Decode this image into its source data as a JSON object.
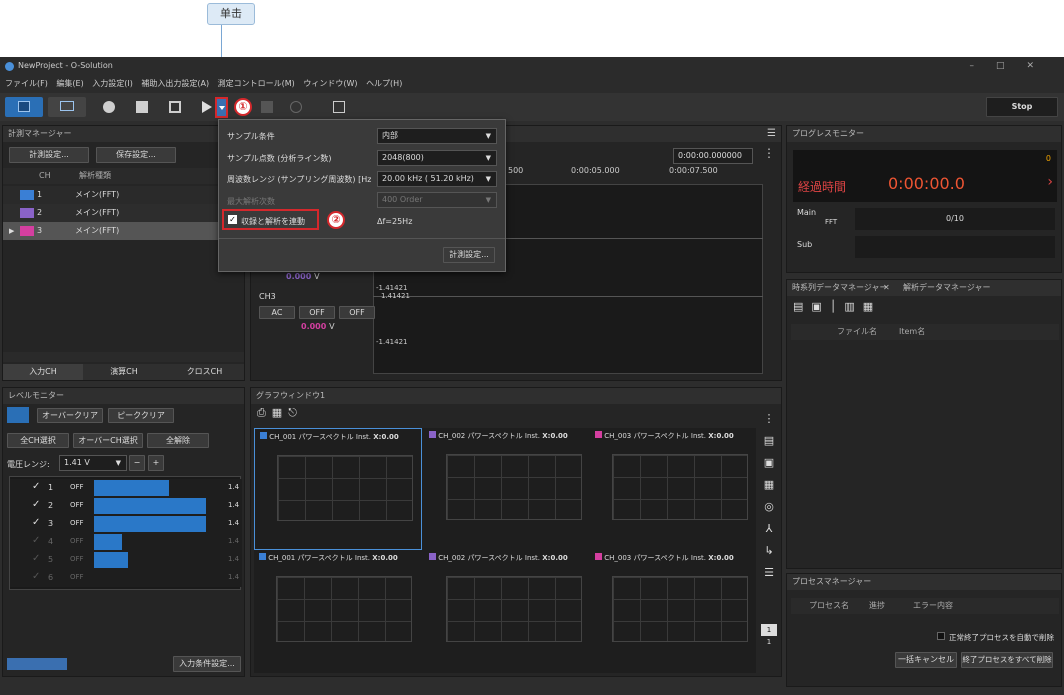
{
  "callout": {
    "label": "单击"
  },
  "window": {
    "title": "NewProject - O-Solution",
    "buttons": "–□✕"
  },
  "menu": {
    "items": [
      "ファイル(F)",
      "編集(E)",
      "入力設定(I)",
      "補助入出力設定(A)",
      "測定コントロール(M)",
      "ウィンドウ(W)",
      "ヘルプ(H)"
    ]
  },
  "toolbar": {
    "stop_label": "Stop",
    "step1": "①",
    "step2": "②"
  },
  "measure_manager": {
    "title": "計測マネージャー",
    "btn_measure": "計測設定...",
    "btn_save": "保存設定...",
    "col_ch": "CH",
    "col_type": "解析種類",
    "rows": [
      {
        "ch": "1",
        "type": "メイン(FFT)",
        "color": "#3a7fd5"
      },
      {
        "ch": "2",
        "type": "メイン(FFT)",
        "color": "#8a63c8"
      },
      {
        "ch": "3",
        "type": "メイン(FFT)",
        "color": "#d43fa0"
      }
    ],
    "tabs": [
      "入力CH",
      "演算CH",
      "クロスCH"
    ]
  },
  "popup": {
    "sample_condition": "サンプル条件",
    "sample_condition_val": "内部",
    "sample_points": "サンプル点数 (分析ライン数)",
    "sample_points_val": "2048(800)",
    "freq_range": "周波数レンジ (サンプリング周波数) [Hz]",
    "freq_range_val": "20.00 kHz ( 51.20 kHz)",
    "max_order": "最大解析次数",
    "max_order_val": "400 Order",
    "sync_label": "収録と解析を連動",
    "delta_f": "Δf=25Hz",
    "btn_measure": "計測設定..."
  },
  "wave": {
    "time_input": "0:00:00.000000",
    "ticks": [
      "500",
      "0:00:05.000",
      "0:00:07.500"
    ],
    "ch3_label": "CH3",
    "ch3_ac": "AC",
    "ch3_off1": "OFF",
    "ch3_off2": "OFF",
    "ch2_value": "0.000",
    "ch3_value": "0.000",
    "unit": "V",
    "neg1": "-1.41421",
    "pos": "1.41421",
    "neg2": "-1.41421"
  },
  "progress": {
    "title": "プログレスモニター",
    "elapsed_label": "経過時間",
    "elapsed_value": "0:00:00.0",
    "count": "0",
    "main_label": "Main",
    "main_type": "FFT",
    "main_progress": "0/10",
    "sub_label": "Sub"
  },
  "data_manager": {
    "tab1": "時系列データマネージャー",
    "tab2": "解析データマネージャー",
    "col_file": "ファイル名",
    "col_item": "Item名"
  },
  "process": {
    "title": "プロセスマネージャー",
    "col_name": "プロセス名",
    "col_progress": "進捗",
    "col_error": "エラー内容",
    "auto_delete": "正常終了プロセスを自動で削除",
    "btn_cancel": "一括キャンセル",
    "btn_delete": "終了プロセスをすべて削除"
  },
  "level": {
    "title": "レベルモニター",
    "btn_over": "オーバークリア",
    "btn_peak": "ピーククリア",
    "btn_allch": "全CH選択",
    "btn_overch": "オーバーCH選択",
    "btn_clear": "全解除",
    "range_label": "電圧レンジ:",
    "range_val": "1.41 V",
    "rows": [
      {
        "ch": "1",
        "off": "OFF",
        "level": 0.55,
        "active": true
      },
      {
        "ch": "2",
        "off": "OFF",
        "level": 0.85,
        "active": true
      },
      {
        "ch": "3",
        "off": "OFF",
        "level": 0.85,
        "active": true
      },
      {
        "ch": "4",
        "off": "OFF",
        "level": 0.22,
        "active": false
      },
      {
        "ch": "5",
        "off": "OFF",
        "level": 0.26,
        "active": false
      },
      {
        "ch": "6",
        "off": "OFF",
        "level": 0.0,
        "active": false
      }
    ],
    "side_val": "1.4",
    "btn_input_cond": "入力条件設定..."
  },
  "graph": {
    "title": "グラフウィンドウ1",
    "cells": [
      {
        "ch": "CH_001",
        "type": "パワースペクトル",
        "inst": "Inst.",
        "x": "X:0.00",
        "color": "#3a7fd5"
      },
      {
        "ch": "CH_002",
        "type": "パワースペクトル",
        "inst": "Inst.",
        "x": "X:0.00",
        "color": "#8a63c8"
      },
      {
        "ch": "CH_003",
        "type": "パワースペクトル",
        "inst": "Inst.",
        "x": "X:0.00",
        "color": "#d43fa0"
      },
      {
        "ch": "CH_001",
        "type": "パワースペクトル",
        "inst": "Inst.",
        "x": "X:0.00",
        "color": "#3a7fd5"
      },
      {
        "ch": "CH_002",
        "type": "パワースペクトル",
        "inst": "Inst.",
        "x": "X:0.00",
        "color": "#8a63c8"
      },
      {
        "ch": "CH_003",
        "type": "パワースペクトル",
        "inst": "Inst.",
        "x": "X:0.00",
        "color": "#d43fa0"
      }
    ],
    "page_num": "1",
    "page_total": "1"
  }
}
